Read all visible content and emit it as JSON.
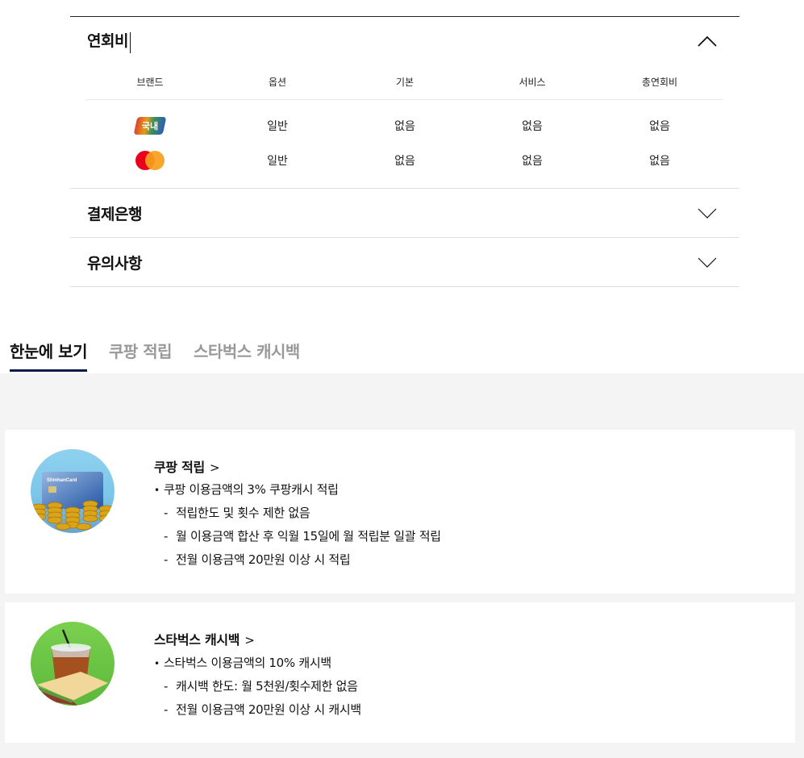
{
  "accordion": {
    "fee_section": {
      "title": "연회비",
      "columns": [
        "브랜드",
        "옵션",
        "기본",
        "서비스",
        "총연회비"
      ],
      "rows": [
        {
          "brand": "국내",
          "brand_type": "domestic",
          "option": "일반",
          "basic": "없음",
          "service": "없음",
          "total": "없음"
        },
        {
          "brand": "",
          "brand_type": "mastercard",
          "option": "일반",
          "basic": "없음",
          "service": "없음",
          "total": "없음"
        }
      ]
    },
    "payment_bank": {
      "title": "결제은행"
    },
    "notes": {
      "title": "유의사항"
    }
  },
  "tabs": {
    "overview": "한눈에 보기",
    "coupang": "쿠팡 적립",
    "starbucks": "스타벅스 캐시백"
  },
  "cards": {
    "coupang": {
      "title": "쿠팡 적립",
      "arrow": ">",
      "card_brand_text": "ShinhanCard",
      "bullet": "쿠팡 이용금액의 3% 쿠팡캐시 적립",
      "sub": [
        "적립한도 및 횟수 제한 없음",
        "월 이용금액 합산 후 익월 15일에 월 적립분 일괄 적립",
        "전월 이용금액 20만원 이상 시 적립"
      ]
    },
    "starbucks": {
      "title": "스타벅스 캐시백",
      "arrow": ">",
      "bullet": "스타벅스 이용금액의 10% 캐시백",
      "sub": [
        "캐시백 한도: 월 5천원/횟수제한 없음",
        "전월 이용금액 20만원 이상 시 캐시백"
      ]
    }
  },
  "colors": {
    "tab_active_underline": "#0a1a4a",
    "gray_bg": "#f4f4f4",
    "mastercard_red": "#eb001b",
    "mastercard_orange": "#f79e1b"
  }
}
